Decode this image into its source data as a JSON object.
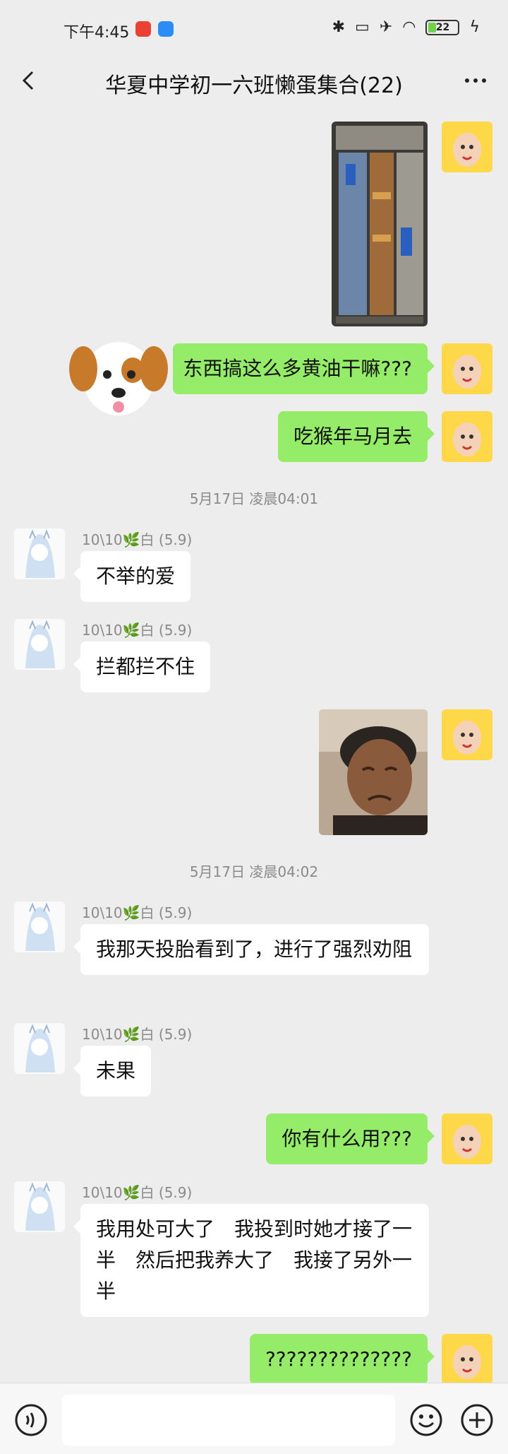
{
  "status_bar": {
    "time": "下午4:45",
    "battery": "22"
  },
  "header": {
    "title": "华夏中学初一六班懒蛋集合(22)",
    "back_icon": "chevron-left-icon",
    "more_icon": "more-horizontal-icon"
  },
  "messages": [
    {
      "id": "m1",
      "side": "me",
      "kind": "image",
      "image": "game-screenshot"
    },
    {
      "id": "m2",
      "side": "me",
      "kind": "text",
      "text": "东西搞这么多黄油干嘛???"
    },
    {
      "id": "m3",
      "side": "me",
      "kind": "text",
      "text": "吃猴年马月去"
    },
    {
      "id": "t1",
      "kind": "timestamp",
      "text": "5月17日 凌晨04:01"
    },
    {
      "id": "m4",
      "side": "other",
      "kind": "text",
      "sender": "10\\10🌿白 (5.9)",
      "text": "不举的爱"
    },
    {
      "id": "m5",
      "side": "other",
      "kind": "text",
      "sender": "10\\10🌿白 (5.9)",
      "text": "拦都拦不住"
    },
    {
      "id": "m6",
      "side": "me",
      "kind": "image",
      "image": "crying-old-man-photo"
    },
    {
      "id": "t2",
      "kind": "timestamp",
      "text": "5月17日 凌晨04:02"
    },
    {
      "id": "m7",
      "side": "other",
      "kind": "text",
      "sender": "10\\10🌿白 (5.9)",
      "text": "我那天投胎看到了，进行了强烈劝阻"
    },
    {
      "id": "m8",
      "side": "other",
      "kind": "text",
      "sender": "10\\10🌿白 (5.9)",
      "text": "未果"
    },
    {
      "id": "m9",
      "side": "me",
      "kind": "text",
      "text": "你有什么用???"
    },
    {
      "id": "m10",
      "side": "other",
      "kind": "text",
      "sender": "10\\10🌿白 (5.9)",
      "text": "我用处可大了　我投到时她才接了一半　然后把我养大了　我接了另外一半"
    },
    {
      "id": "m11",
      "side": "me",
      "kind": "text",
      "text": "??????????????"
    }
  ],
  "bottom_bar": {
    "voice_icon": "voice-icon",
    "emoji_icon": "emoji-icon",
    "plus_icon": "plus-icon"
  },
  "colors": {
    "background": "#ededed",
    "my_bubble": "#95ec69",
    "other_bubble": "#ffffff"
  }
}
